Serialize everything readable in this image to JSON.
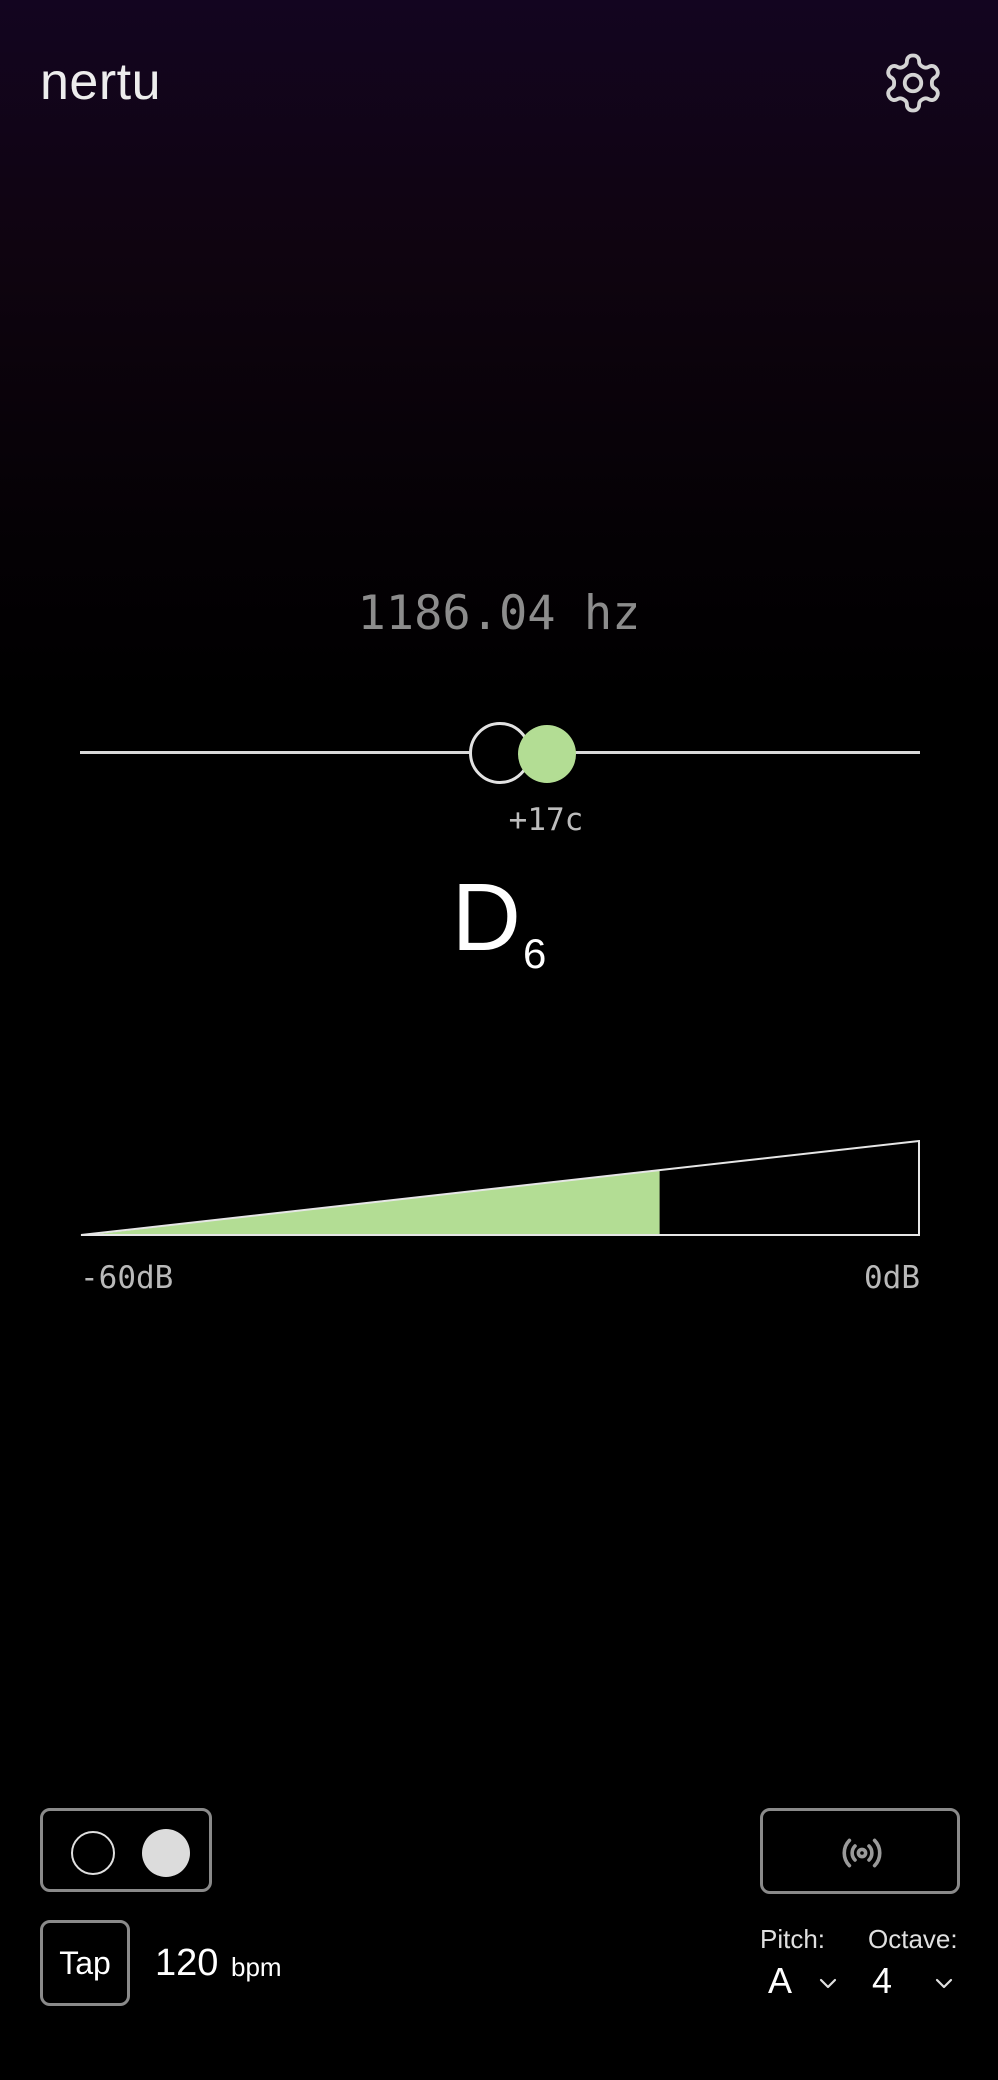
{
  "app": {
    "title": "nertu"
  },
  "header": {
    "settings_icon": "gear-icon"
  },
  "tuner": {
    "frequency": "1186.04 hz",
    "cents": "+17c",
    "cents_value": 17,
    "note": {
      "letter": "D",
      "octave": "6"
    }
  },
  "meter": {
    "min_label": "-60dB",
    "max_label": "0dB",
    "level_fraction": 0.69,
    "fill_color": "#b3dd94"
  },
  "controls": {
    "toggle_icon": "toggle-switch",
    "tone_icon": "broadcast-icon",
    "tap_label": "Tap",
    "bpm_value": "120",
    "bpm_unit": "bpm",
    "pitch_label": "Pitch:",
    "pitch_value": "A",
    "octave_label": "Octave:",
    "octave_value": "4"
  },
  "colors": {
    "accent": "#b3dd94",
    "border": "#8a8a8a",
    "text_dim": "#8c8c8c"
  }
}
